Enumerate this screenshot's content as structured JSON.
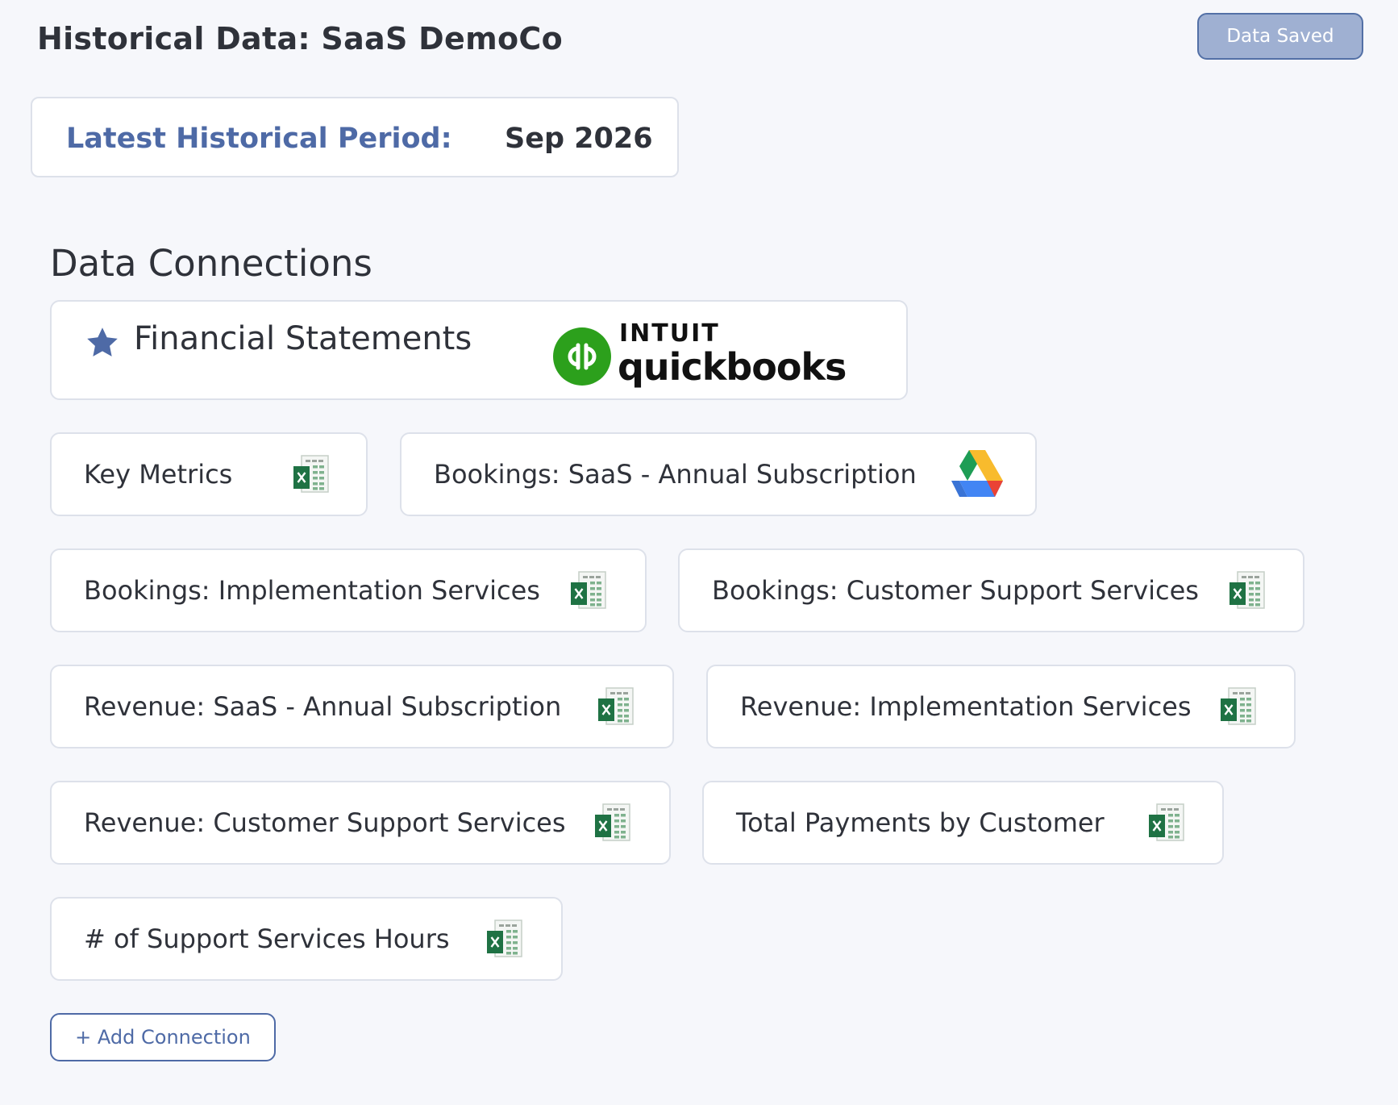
{
  "header": {
    "title": "Historical Data: SaaS DemoCo",
    "saved_label": "Data Saved"
  },
  "period": {
    "label": "Latest Historical Period:",
    "value": "Sep 2026"
  },
  "connections": {
    "heading": "Data Connections",
    "primary": {
      "label": "Financial Statements",
      "logo_brand": "INTUIT",
      "logo_product": "quickbooks"
    },
    "items": [
      {
        "label": "Key Metrics",
        "source": "excel-icon"
      },
      {
        "label": "Bookings: SaaS - Annual Subscription",
        "source": "google-drive-icon"
      },
      {
        "label": "Bookings: Implementation Services",
        "source": "excel-icon"
      },
      {
        "label": "Bookings: Customer Support Services",
        "source": "excel-icon"
      },
      {
        "label": "Revenue: SaaS - Annual Subscription",
        "source": "excel-icon"
      },
      {
        "label": "Revenue: Implementation Services",
        "source": "excel-icon"
      },
      {
        "label": "Revenue: Customer Support Services",
        "source": "excel-icon"
      },
      {
        "label": "Total Payments by Customer",
        "source": "excel-icon"
      },
      {
        "label": "# of Support Services Hours",
        "source": "excel-icon"
      }
    ],
    "add_label": "+ Add Connection"
  },
  "colors": {
    "accent": "#4e6aa6",
    "saved_button_bg": "#9fb0d2",
    "quickbooks_green": "#2ca01c",
    "excel_green": "#1f7244"
  }
}
